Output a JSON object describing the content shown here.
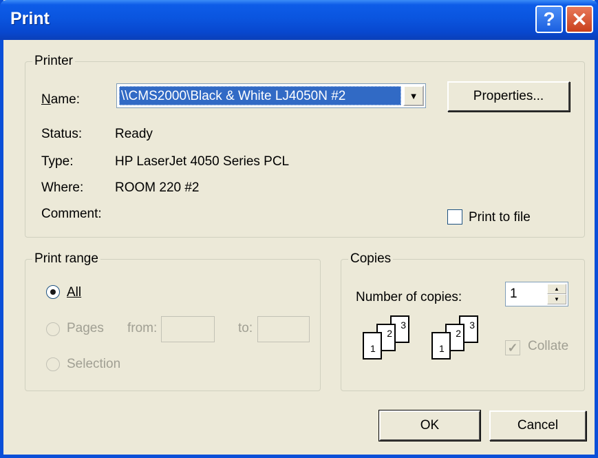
{
  "dialog": {
    "title": "Print",
    "help_button": "?",
    "close_button": "✕"
  },
  "printer": {
    "group_label": "Printer",
    "name_label": "Name:",
    "name_value": "\\\\CMS2000\\Black & White LJ4050N #2",
    "properties_button": "Properties...",
    "status_label": "Status:",
    "status_value": "Ready",
    "type_label": "Type:",
    "type_value": "HP LaserJet 4050 Series PCL",
    "where_label": "Where:",
    "where_value": "ROOM 220 #2",
    "comment_label": "Comment:",
    "print_to_file_label": "Print to file",
    "print_to_file_checked": false
  },
  "print_range": {
    "group_label": "Print range",
    "all_label": "All",
    "pages_label": "Pages",
    "from_label": "from:",
    "to_label": "to:",
    "from_value": "",
    "to_value": "",
    "selection_label": "Selection",
    "selected": "All"
  },
  "copies": {
    "group_label": "Copies",
    "number_label": "Number of copies:",
    "number_value": "1",
    "collate_label": "Collate",
    "collate_checked": true,
    "page_numbers": [
      "1",
      "2",
      "3"
    ]
  },
  "buttons": {
    "ok": "OK",
    "cancel": "Cancel"
  },
  "colors": {
    "titlebar": "#0a55df",
    "face": "#ece9d8",
    "selection": "#316ac5",
    "disabled_text": "#a09f93"
  }
}
